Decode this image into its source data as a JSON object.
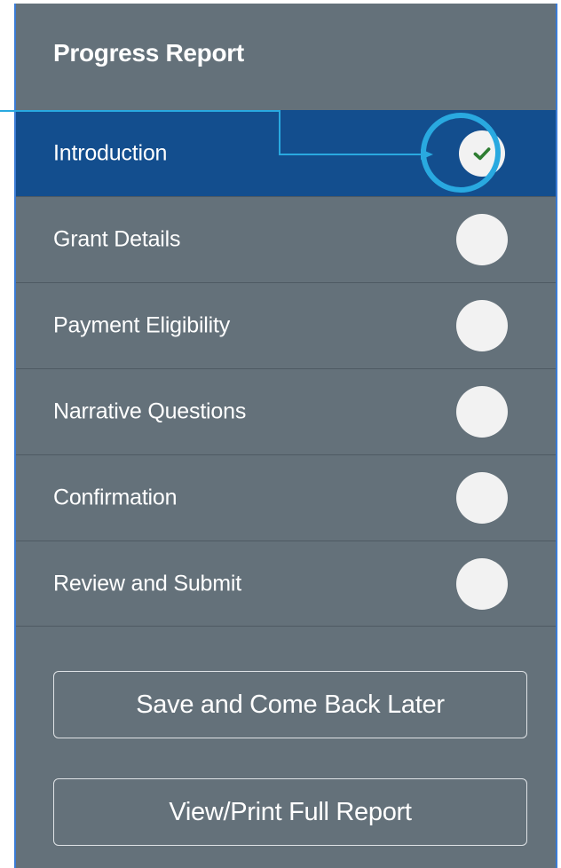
{
  "panel": {
    "title": "Progress Report"
  },
  "nav": {
    "items": [
      {
        "label": "Introduction",
        "status": "complete",
        "status_icon": "check-icon"
      },
      {
        "label": "Grant Details",
        "status": "incomplete"
      },
      {
        "label": "Payment Eligibility",
        "status": "incomplete"
      },
      {
        "label": "Narrative Questions",
        "status": "incomplete"
      },
      {
        "label": "Confirmation",
        "status": "incomplete"
      },
      {
        "label": "Review and Submit",
        "status": "incomplete"
      }
    ]
  },
  "actions": {
    "save_label": "Save and Come Back Later",
    "print_label": "View/Print Full Report"
  },
  "colors": {
    "panel_bg": "#64717a",
    "active_bg": "#134e8e",
    "callout": "#29a9e0",
    "check": "#2e7d32",
    "status_circle": "#f2f2f2"
  }
}
